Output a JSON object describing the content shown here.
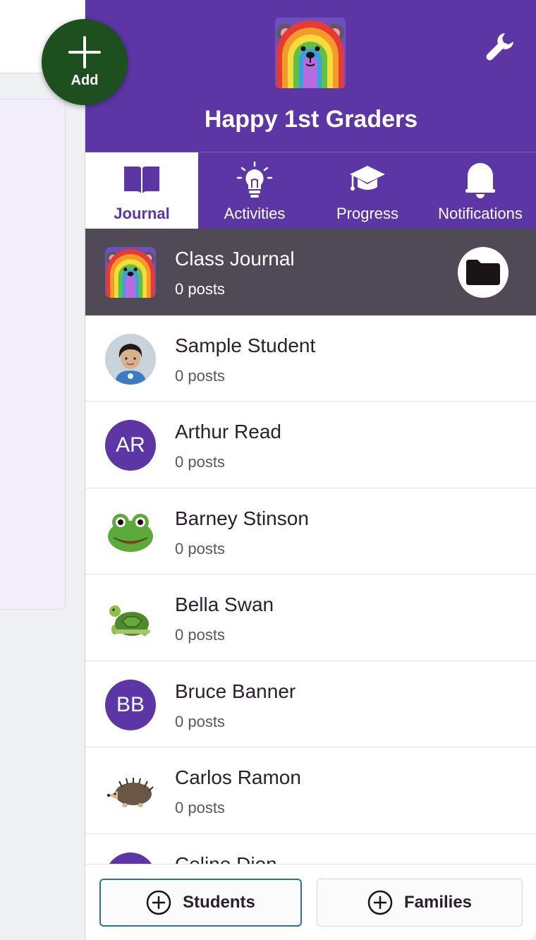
{
  "add_button": {
    "label": "Add"
  },
  "class": {
    "title": "Happy 1st Graders"
  },
  "tabs": [
    {
      "label": "Journal",
      "icon": "book-icon",
      "active": true
    },
    {
      "label": "Activities",
      "icon": "lightbulb-icon",
      "active": false
    },
    {
      "label": "Progress",
      "icon": "graduation-cap-icon",
      "active": false
    },
    {
      "label": "Notifications",
      "icon": "bell-icon",
      "active": false
    }
  ],
  "class_journal": {
    "name": "Class Journal",
    "posts": "0 posts"
  },
  "students": [
    {
      "name": "Sample Student",
      "posts": "0 posts",
      "avatar": "person-avatar"
    },
    {
      "name": "Arthur Read",
      "posts": "0 posts",
      "avatar_initials": "AR"
    },
    {
      "name": "Barney Stinson",
      "posts": "0 posts",
      "avatar": "frog-avatar"
    },
    {
      "name": "Bella Swan",
      "posts": "0 posts",
      "avatar": "turtle-avatar"
    },
    {
      "name": "Bruce Banner",
      "posts": "0 posts",
      "avatar_initials": "BB"
    },
    {
      "name": "Carlos Ramon",
      "posts": "0 posts",
      "avatar": "hedgehog-avatar"
    },
    {
      "name": "Celine Dion",
      "posts": "",
      "avatar_initials": ""
    }
  ],
  "footer": {
    "students_label": "Students",
    "families_label": "Families"
  },
  "colors": {
    "brand_purple": "#5c36a4",
    "fab_green": "#1d4f1f",
    "featured_row": "#4f4a56",
    "students_border": "#2f6cb6"
  }
}
